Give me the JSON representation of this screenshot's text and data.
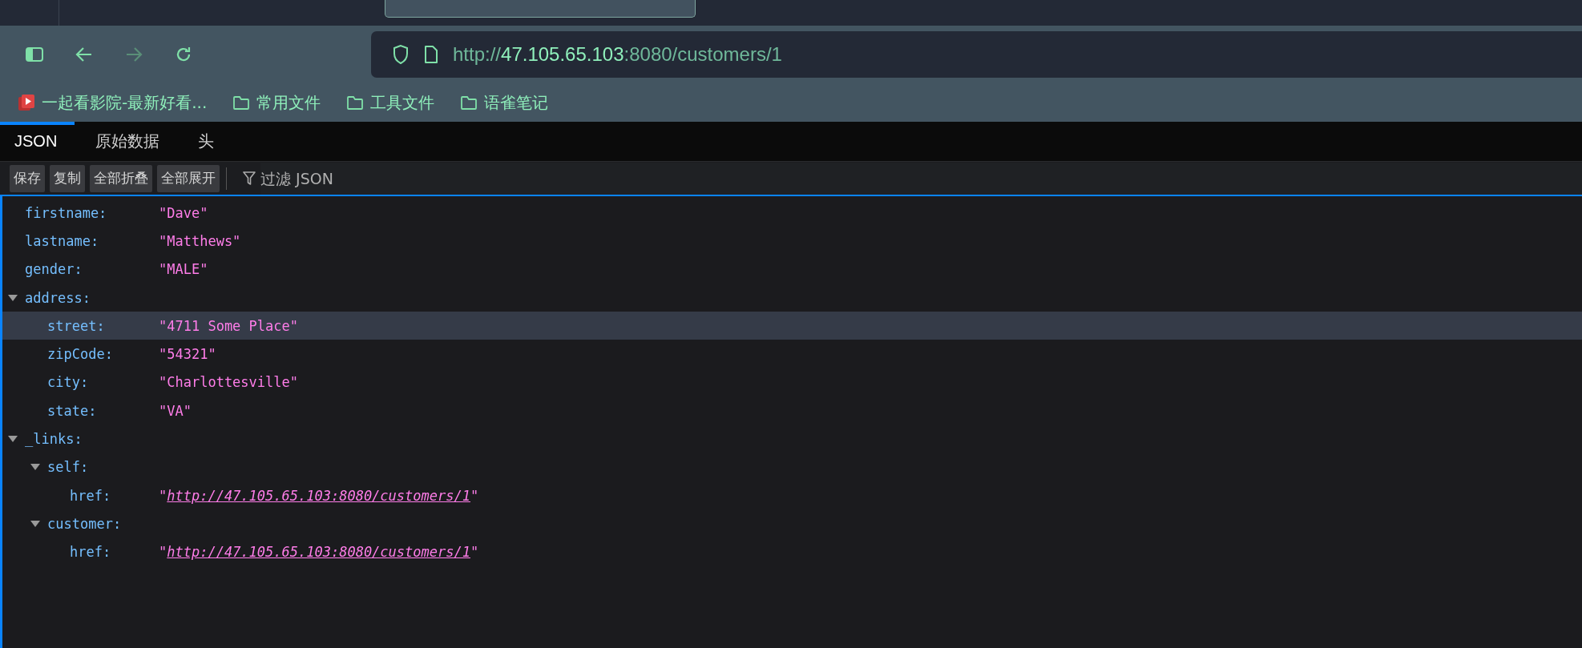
{
  "address_bar": {
    "scheme": "http://",
    "host": "47.105.65.103",
    "rest": ":8080/customers/1"
  },
  "nav": {
    "back_disabled": false,
    "forward_disabled": true
  },
  "bookmarks": [
    {
      "kind": "site",
      "label": "一起看影院-最新好看..."
    },
    {
      "kind": "folder",
      "label": "常用文件"
    },
    {
      "kind": "folder",
      "label": "工具文件"
    },
    {
      "kind": "folder",
      "label": "语雀笔记"
    }
  ],
  "viewer_tabs": [
    {
      "label": "JSON",
      "selected": true
    },
    {
      "label": "原始数据",
      "selected": false
    },
    {
      "label": "头",
      "selected": false
    }
  ],
  "toolbar_buttons": [
    "保存",
    "复制",
    "全部折叠",
    "全部展开"
  ],
  "filter": {
    "placeholder": "过滤 JSON"
  },
  "tree": [
    {
      "key": "firstname:",
      "value": "\"Dave\"",
      "kind": "string",
      "selected": false
    },
    {
      "key": "lastname:",
      "value": "\"Matthews\"",
      "kind": "string",
      "selected": false
    },
    {
      "key": "gender:",
      "value": "\"MALE\"",
      "kind": "string",
      "selected": false
    },
    {
      "key": "address:",
      "kind": "object",
      "expanded": true,
      "selected": false,
      "children": [
        {
          "key": "street:",
          "value": "\"4711 Some Place\"",
          "kind": "string",
          "selected": true
        },
        {
          "key": "zipCode:",
          "value": "\"54321\"",
          "kind": "string",
          "selected": false
        },
        {
          "key": "city:",
          "value": "\"Charlottesville\"",
          "kind": "string",
          "selected": false
        },
        {
          "key": "state:",
          "value": "\"VA\"",
          "kind": "string",
          "selected": false
        }
      ]
    },
    {
      "key": "_links:",
      "kind": "object",
      "expanded": true,
      "selected": false,
      "children": [
        {
          "key": "self:",
          "kind": "object",
          "expanded": true,
          "selected": false,
          "children": [
            {
              "key": "href:",
              "value": "\"*http://47.105.65.103:8080/customers/1*\"",
              "kind": "link",
              "selected": false
            }
          ]
        },
        {
          "key": "customer:",
          "kind": "object",
          "expanded": true,
          "selected": false,
          "children": [
            {
              "key": "href:",
              "value": "\"*http://47.105.65.103:8080/customers/1*\"",
              "kind": "link",
              "selected": false
            }
          ]
        }
      ]
    }
  ]
}
